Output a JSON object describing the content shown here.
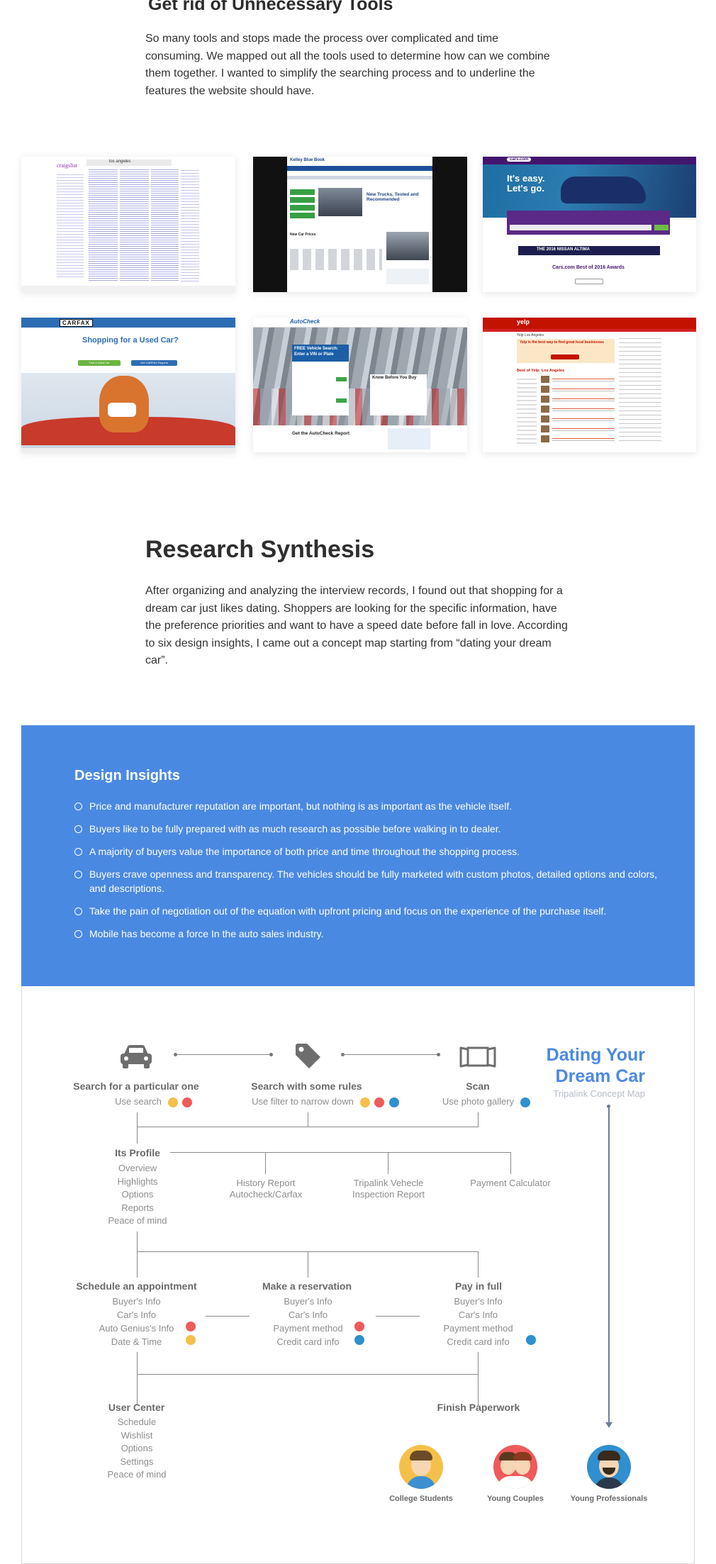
{
  "tools_section": {
    "heading": "Get rid of Unnecessary Tools",
    "paragraph": "So many tools and stops made the process over complicated and time consuming. We mapped out all the tools used to determine how can we combine them together. I wanted to simplify the searching process and to underline the features the website should have."
  },
  "screenshots": {
    "craigslist": {
      "logo": "craigslist",
      "location": "los angeles"
    },
    "kbb": {
      "logo": "Kelley Blue Book",
      "headline": "New Trucks, Tested and Recommended",
      "section": "New Car Prices"
    },
    "cars": {
      "logo": "cars.com",
      "headline_1": "It's easy.",
      "headline_2": "Let's go.",
      "banner": "THE 2016 NISSAN ALTIMA",
      "award": "Cars.com Best of 2016 Awards"
    },
    "carfax": {
      "logo": "CARFAX",
      "headline": "Shopping for a Used Car?",
      "button_1": "Find a Used Car",
      "button_2": "Get CARFAX Reports"
    },
    "autocheck": {
      "logo": "AutoCheck",
      "headline": "FREE Vehicle Search: Enter a VIN or Plate",
      "side_title": "Know Before You Buy",
      "bottom_title": "Get the AutoCheck Report"
    },
    "yelp": {
      "logo": "yelp",
      "location": "Yelp Los Angeles",
      "promo": "Yelp is the best way to find great local businesses",
      "section": "Best of Yelp: Los Angeles"
    }
  },
  "research_section": {
    "heading": "Research Synthesis",
    "paragraph": "After organizing and analyzing the interview records, I found out that shopping for a dream car just likes dating. Shoppers are looking for the specific information, have the preference priorities and want to have a speed date before fall in love. According to six design insights, I came out a concept map starting from “dating your dream car”."
  },
  "design_insights": {
    "title": "Design Insights",
    "items": [
      "Price and manufacturer reputation are important, but nothing is as important as the vehicle itself.",
      "Buyers like to be fully prepared with as much research as possible before walking in to dealer.",
      "A majority of buyers value the importance of both price and time throughout the shopping process.",
      "Buyers crave openness and transparency. The vehicles should be fully marketed with custom photos, detailed options and colors, and descriptions.",
      "Take the pain of negotiation out of the equation with upfront pricing and focus on the experience of the purchase itself.",
      "Mobile has become a force In the auto sales industry."
    ]
  },
  "concept_map": {
    "title_line1": "Dating Your",
    "title_line2": "Dream Car",
    "subtitle": "Tripalink Concept Map",
    "accent_color": "#4a89e2",
    "nodes": {
      "search": {
        "title": "Search for a particular one",
        "sub": "Use search",
        "icon": "car-icon"
      },
      "rules": {
        "title": "Search with some rules",
        "sub": "Use filter to narrow down",
        "icon": "tag-icon"
      },
      "scan": {
        "title": "Scan",
        "sub": "Use photo gallery",
        "icon": "gallery-icon"
      },
      "profile": {
        "title": "Its Profile",
        "items": [
          "Overview",
          "Highlights",
          "Options",
          "Reports",
          "Peace of mind"
        ]
      },
      "history": {
        "line1": "History Report",
        "line2": "Autocheck/Carfax"
      },
      "inspection": {
        "line1": "Tripalink Vehecle",
        "line2": "Inspection Report"
      },
      "calculator": {
        "line1": "Payment Calculator"
      },
      "appointment": {
        "title": "Schedule an appointment",
        "items": [
          "Buyer's Info",
          "Car's Info",
          "Auto Genius's Info",
          "Date & Time"
        ]
      },
      "reservation": {
        "title": "Make a reservation",
        "items": [
          "Buyer's Info",
          "Car's Info",
          "Payment method",
          "Credit card info"
        ]
      },
      "payfull": {
        "title": "Pay in full",
        "items": [
          "Buyer's Info",
          "Car's Info",
          "Payment method",
          "Credit card info"
        ]
      },
      "user_center": {
        "title": "User Center",
        "items": [
          "Schedule",
          "Wishlist",
          "Options",
          "Settings",
          "Peace of mind"
        ]
      },
      "paperwork": {
        "title": "Finish Paperwork"
      }
    },
    "personas": [
      {
        "label": "College Students",
        "color": "#f5c04a"
      },
      {
        "label": "Young Couples",
        "color": "#ef5a5a"
      },
      {
        "label": "Young Professionals",
        "color": "#2f8fcf"
      }
    ]
  }
}
